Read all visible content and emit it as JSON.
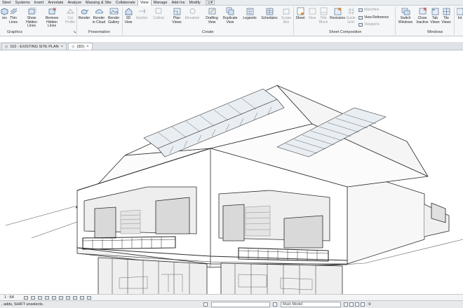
{
  "ribbon_tabs": [
    "Steel",
    "Systems",
    "Insert",
    "Annotate",
    "Analyze",
    "Massing & Site",
    "Collaborate",
    "View",
    "Manage",
    "Add-Ins",
    "Modify"
  ],
  "active_tab": "View",
  "quick_access": "⊂▾",
  "ribbon": {
    "graphics": {
      "buttons": [
        "ies",
        "Thin Lines",
        "Show Hidden Lines",
        "Remove Hidden Lines",
        "Cut Profile"
      ],
      "label": "Graphics"
    },
    "presentation": {
      "buttons": [
        "Render",
        "Render in Cloud",
        "Render Gallery"
      ],
      "label": "Presentation"
    },
    "create": {
      "buttons": [
        "3D View",
        "Section",
        "Callout",
        "Plan Views",
        "Elevation",
        "Drafting View",
        "Duplicate View",
        "Legends",
        "Schedules",
        "Scope Box"
      ],
      "label": "Create"
    },
    "sheet_composition": {
      "buttons": [
        "Sheet",
        "View",
        "Title Block",
        "Revisions",
        "Guide Grid"
      ],
      "small": [
        "Matchline",
        "View Reference",
        "Viewports"
      ],
      "label": "Sheet Composition"
    },
    "windows": {
      "buttons": [
        "Switch Windows",
        "Close Inactive",
        "Tab Views",
        "Tile Views"
      ],
      "label": "Windows"
    },
    "cut_off": "Int"
  },
  "doc_tabs": [
    {
      "label": "102 - EXISTING SITE PLAN",
      "active": false
    },
    {
      "label": "{3D}",
      "active": true
    }
  ],
  "view_bar": {
    "scale": "1 : 64"
  },
  "status": {
    "message": ", adds, SHIFT unselects.",
    "workset": "Main Model",
    "filter_count": ":0"
  },
  "colors": {
    "ribbon_bg": "#f5f6f7",
    "active_tab_bg": "#ffffff",
    "canvas_bg": "#ffffff",
    "line": "#2b2b2b"
  }
}
